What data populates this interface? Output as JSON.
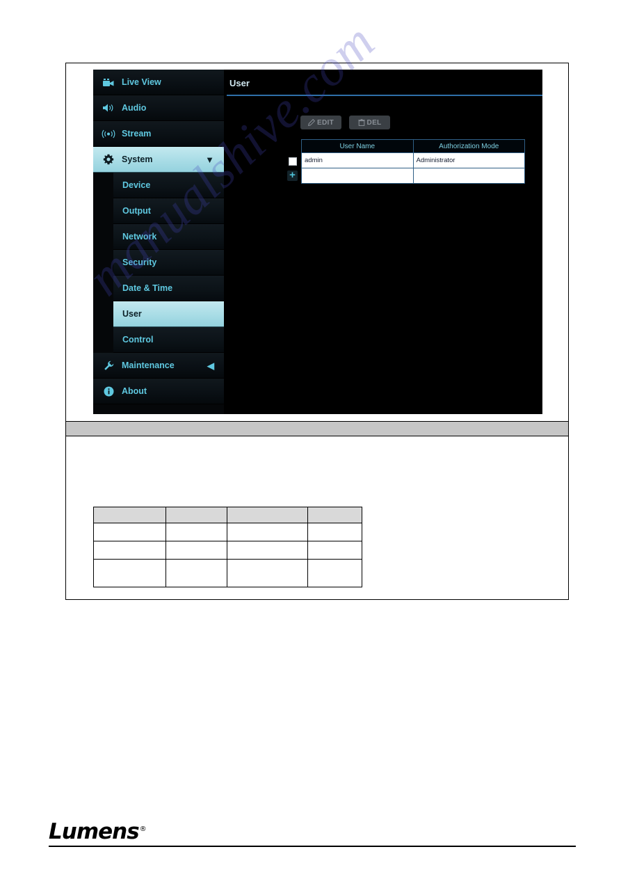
{
  "watermark": {
    "text": "manualshive.com"
  },
  "sidebar": {
    "items": [
      {
        "label": "Live View",
        "icon": "video-camera-icon",
        "active": false,
        "arrow": ""
      },
      {
        "label": "Audio",
        "icon": "speaker-icon",
        "active": false,
        "arrow": ""
      },
      {
        "label": "Stream",
        "icon": "broadcast-icon",
        "active": false,
        "arrow": ""
      },
      {
        "label": "System",
        "icon": "gear-icon",
        "active": true,
        "arrow": "▼"
      }
    ],
    "sub_items": [
      {
        "label": "Device",
        "selected": false
      },
      {
        "label": "Output",
        "selected": false
      },
      {
        "label": "Network",
        "selected": false
      },
      {
        "label": "Security",
        "selected": false
      },
      {
        "label": "Date & Time",
        "selected": false
      },
      {
        "label": "User",
        "selected": true
      },
      {
        "label": "Control",
        "selected": false
      }
    ],
    "footer_items": [
      {
        "label": "Maintenance",
        "icon": "wrench-icon",
        "arrow": "◀"
      },
      {
        "label": "About",
        "icon": "info-icon",
        "arrow": ""
      }
    ]
  },
  "content": {
    "title": "User",
    "buttons": [
      {
        "label": "EDIT",
        "icon": "pencil-icon",
        "disabled": true
      },
      {
        "label": "DEL",
        "icon": "trash-icon",
        "disabled": true
      }
    ],
    "table": {
      "columns": [
        "User Name",
        "Authorization Mode"
      ],
      "rows": [
        {
          "user_name": "admin",
          "authorization_mode": "Administrator",
          "checked": false
        },
        {
          "user_name": "",
          "authorization_mode": "",
          "checked": false
        }
      ],
      "add_button_label": "+"
    }
  },
  "spec_table": {
    "header": [
      "",
      "",
      "",
      ""
    ],
    "rows": [
      [
        "",
        "",
        "",
        ""
      ],
      [
        "",
        "",
        "",
        ""
      ],
      [
        "",
        "",
        "",
        ""
      ]
    ]
  },
  "footer": {
    "brand": "Lumens",
    "trademark": "®"
  }
}
